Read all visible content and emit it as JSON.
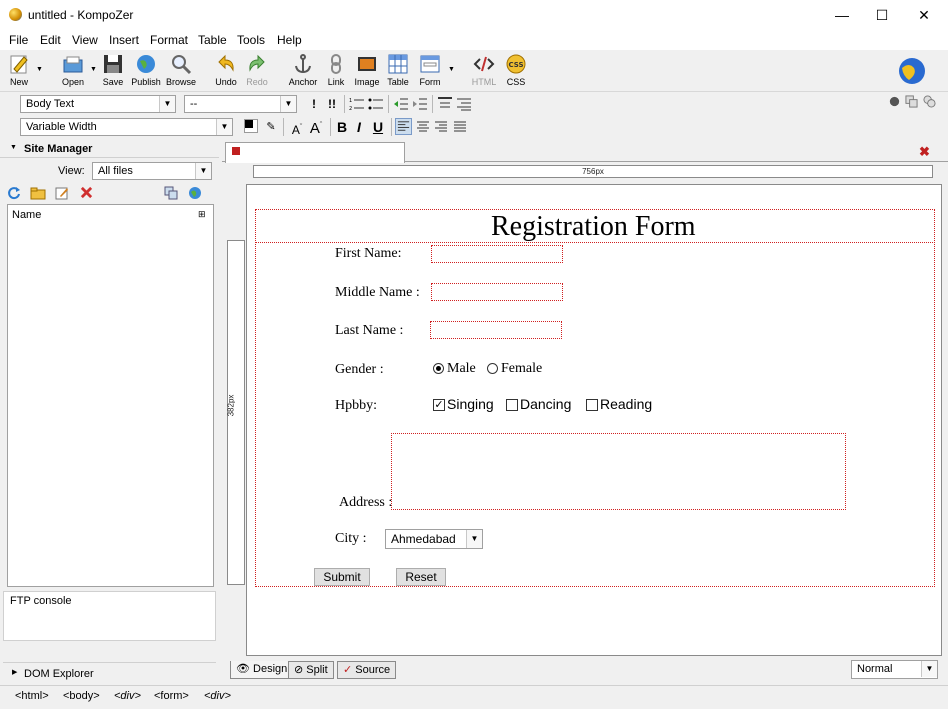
{
  "window": {
    "title": "untitled - KompoZer",
    "minimize": "—",
    "maximize": "☐",
    "close": "✕"
  },
  "menu": [
    "File",
    "Edit",
    "View",
    "Insert",
    "Format",
    "Table",
    "Tools",
    "Help"
  ],
  "toolbar": {
    "new": "New",
    "open": "Open",
    "save": "Save",
    "publish": "Publish",
    "browse": "Browse",
    "undo": "Undo",
    "redo": "Redo",
    "anchor": "Anchor",
    "link": "Link",
    "image": "Image",
    "table": "Table",
    "form": "Form",
    "html": "HTML",
    "css": "CSS"
  },
  "format_bar": {
    "paragraph_style": "Body Text",
    "font_face": "--",
    "width": "Variable Width",
    "bold": "B",
    "italic": "I",
    "underline": "U"
  },
  "site_manager": {
    "title": "Site Manager",
    "view_label": "View:",
    "view_value": "All files",
    "name_header": "Name",
    "ftp_console": "FTP console",
    "dom_explorer": "DOM Explorer"
  },
  "editor": {
    "width_ruler": "756px",
    "height_ruler": "382px",
    "mode_tabs": [
      "Design",
      "Split",
      "Source"
    ],
    "zoom_value": "Normal"
  },
  "form": {
    "heading": "Registration Form",
    "first_name_label": "First Name:",
    "middle_name_label": "Middle Name :",
    "last_name_label": "Last Name :",
    "gender_label": "Gender :",
    "gender_options": [
      "Male",
      "Female"
    ],
    "gender_selected": "Male",
    "hobby_label": "Hpbby:",
    "hobbies": [
      {
        "label": "Singing",
        "checked": true
      },
      {
        "label": "Dancing",
        "checked": false
      },
      {
        "label": "Reading",
        "checked": false
      }
    ],
    "address_label": "Address :",
    "city_label": "City :",
    "city_value": "Ahmedabad",
    "submit": "Submit",
    "reset": "Reset"
  },
  "statusbar": [
    "<html>",
    "<body>",
    "<div>",
    "<form>",
    "<div>"
  ]
}
